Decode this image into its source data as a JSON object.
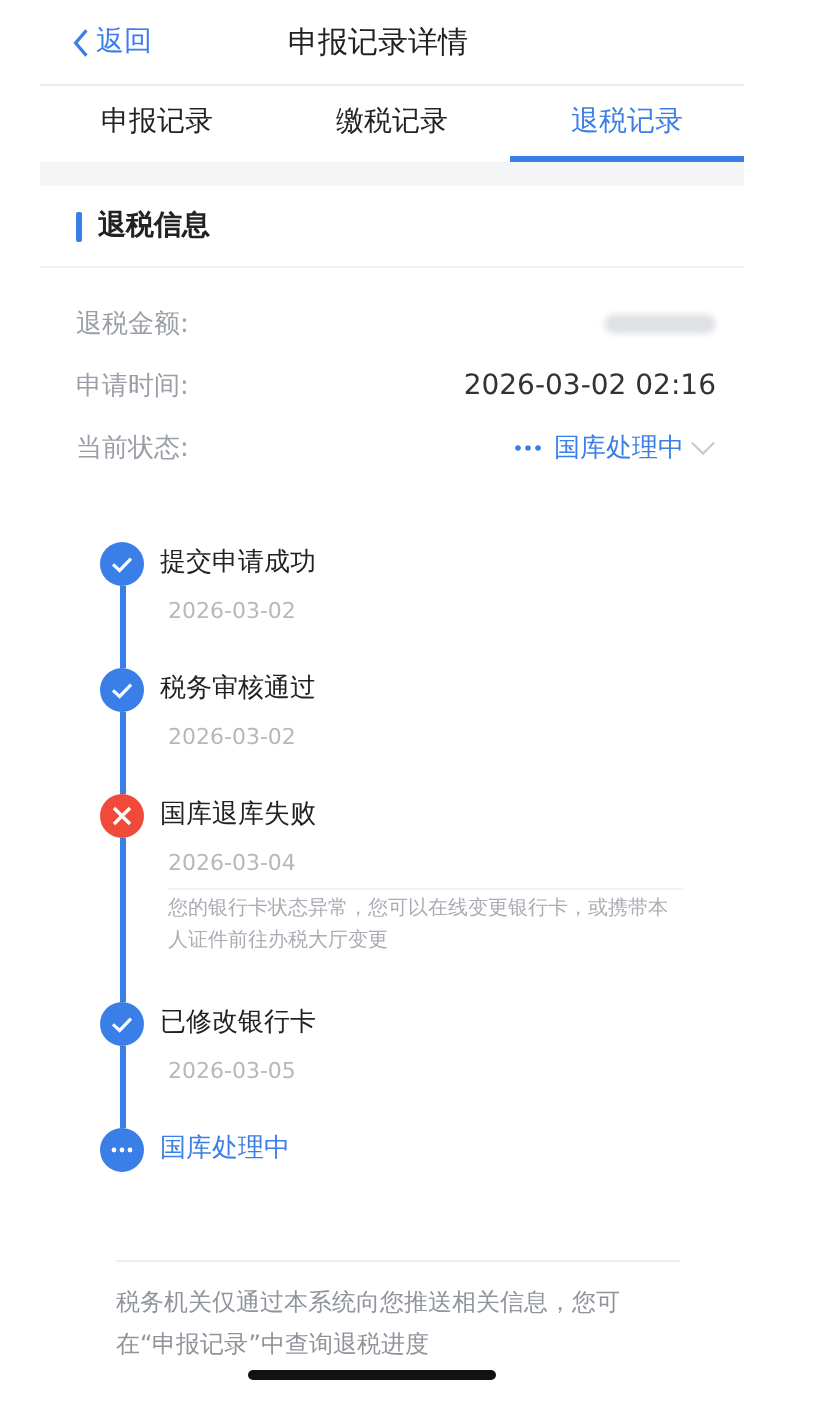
{
  "nav": {
    "back": "返回",
    "title": "申报记录详情"
  },
  "tabs": [
    {
      "label": "申报记录",
      "selected": false
    },
    {
      "label": "缴税记录",
      "selected": false
    },
    {
      "label": "退税记录",
      "selected": true
    }
  ],
  "section": {
    "title": "退税信息"
  },
  "fields": [
    {
      "kind": "redacted",
      "label": "退税金额:"
    },
    {
      "kind": "text",
      "label": "申请时间:",
      "value": "2026-03-02 02:16"
    },
    {
      "kind": "status",
      "label": "当前状态:",
      "value": "国库处理中"
    }
  ],
  "steps": [
    {
      "kind": "done",
      "title": "提交申请成功",
      "date": "2026-03-02"
    },
    {
      "kind": "done",
      "title": "税务审核通过",
      "date": "2026-03-02"
    },
    {
      "kind": "failed",
      "title": "国库退库失败",
      "date": "2026-03-04",
      "note": "您的银行卡状态异常，您可以在线变更银行卡，或携带本人证件前往办税大厅变更"
    },
    {
      "kind": "done",
      "title": "已修改银行卡",
      "date": "2026-03-05"
    },
    {
      "kind": "current",
      "title": "国库处理中"
    }
  ],
  "footer": "税务机关仅通过本系统向您推送相关信息，您可在“申报记录”中查询退税进度"
}
